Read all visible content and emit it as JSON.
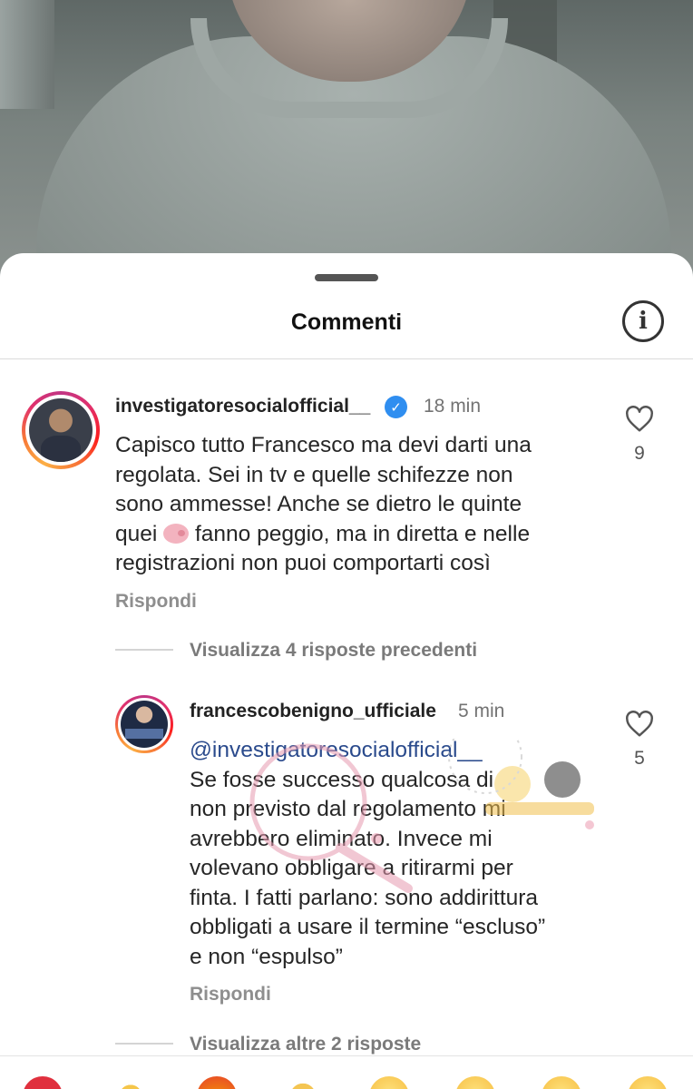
{
  "sheet": {
    "title": "Commenti"
  },
  "comments": [
    {
      "username": "investigatoresocialofficial__",
      "verified": true,
      "time": "18 min",
      "text_lines": [
        "Capisco tutto Francesco ma devi darti una",
        "regolata. Sei in tv e quelle schifezze non",
        "sono ammesse! Anche se dietro le quinte",
        "fanno peggio, ma in diretta e nelle",
        "registrazioni non puoi comportarti così"
      ],
      "line4_prefix": "quei",
      "reply_label": "Rispondi",
      "likes": "9"
    },
    {
      "username": "francescobenigno_ufficiale",
      "verified": false,
      "time": "5 min",
      "mention": "@investigatoresocialofficial__",
      "text_lines": [
        "Se fosse successo qualcosa di",
        "non previsto dal regolamento mi",
        "avrebbero eliminato. Invece mi",
        "volevano obbligare a ritirarmi per",
        "finta. I fatti parlano: sono addirittura",
        "obbligati a usare il termine “escluso”",
        "e non “espulso”"
      ],
      "reply_label": "Rispondi",
      "likes": "5"
    }
  ],
  "view_previous_replies": "Visualizza 4 risposte precedenti",
  "view_more_replies": "Visualizza altre 2 risposte",
  "emoji_bar": [
    "heart",
    "clapping-hands",
    "fire",
    "raising-hands",
    "crying-face",
    "heart-eyes-face",
    "astonished-face",
    "laughing-face"
  ],
  "colors": {
    "verified_blue": "#2f8ef0",
    "mention_blue": "#2a4a8c",
    "heart_red": "#e0303e"
  }
}
